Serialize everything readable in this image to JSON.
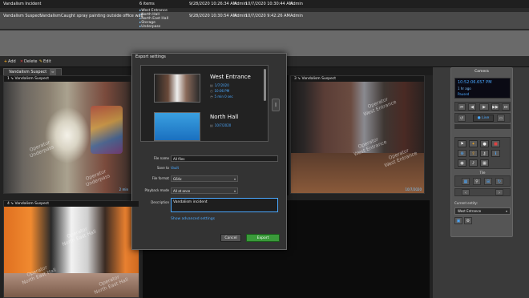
{
  "incidents": {
    "row1": {
      "title": "Vandalism Incident",
      "count": "6 items",
      "created": "9/28/2020 10:26:34 AM",
      "user": "Admin",
      "modified": "10/7/2020 10:30:44 AM",
      "user2": "Admin"
    },
    "row2": {
      "title": "Vandalism Suspect",
      "category": "Vandalism",
      "description": "Caught spray painting outside office wall",
      "created": "9/28/2020 10:30:54 AM",
      "user": "Admin",
      "modified": "10/7/2020 9:42:26 AM",
      "user2": "Admin"
    },
    "sublist": [
      "West Entrance",
      "North Hall",
      "North East Hall",
      "Storage",
      "Underpass"
    ]
  },
  "toolbar": {
    "add": "Add",
    "delete": "Delete",
    "edit": "Edit"
  },
  "tab": {
    "label": "Vandalism Suspect"
  },
  "tiles": {
    "tile1": {
      "title": "Vandalism Suspect",
      "ts": "2 min",
      "wm1": "Operator",
      "wm2": "Underpass"
    },
    "tile3": {
      "title": "Vandalism Suspect",
      "ts": "10/7/2020",
      "wm1": "Operator",
      "wm2": "West Entrance"
    },
    "tile4": {
      "title": "Vandalism Suspect",
      "wm1": "Operator",
      "wm2": "North East Hall"
    }
  },
  "camera": {
    "header": "Camera",
    "time": "10:52:06.657 PM",
    "ago": "1 hr ago",
    "status": "Paused",
    "live": "Live",
    "ptz_label": "Tile",
    "entity_label": "Current entity:",
    "entity": "West Entrance"
  },
  "modal": {
    "title": "Export settings",
    "preview": [
      {
        "name": "West Entrance",
        "date": "1/7/2020",
        "time": "10:06 PM",
        "duration": "5 min 0 sec"
      },
      {
        "name": "North Hall",
        "date": "10/7/2020"
      }
    ],
    "form": {
      "file_name_label": "File name",
      "file_name": "All files",
      "save_to_label": "Save to",
      "save_to": "Vault",
      "file_format_label": "File format",
      "file_format": "G64x",
      "playback_label": "Playback mode",
      "playback": "All at once",
      "description_label": "Description",
      "description": "Vandalism incident"
    },
    "advanced": "Show advanced settings",
    "cancel": "Cancel",
    "export": "Export"
  }
}
